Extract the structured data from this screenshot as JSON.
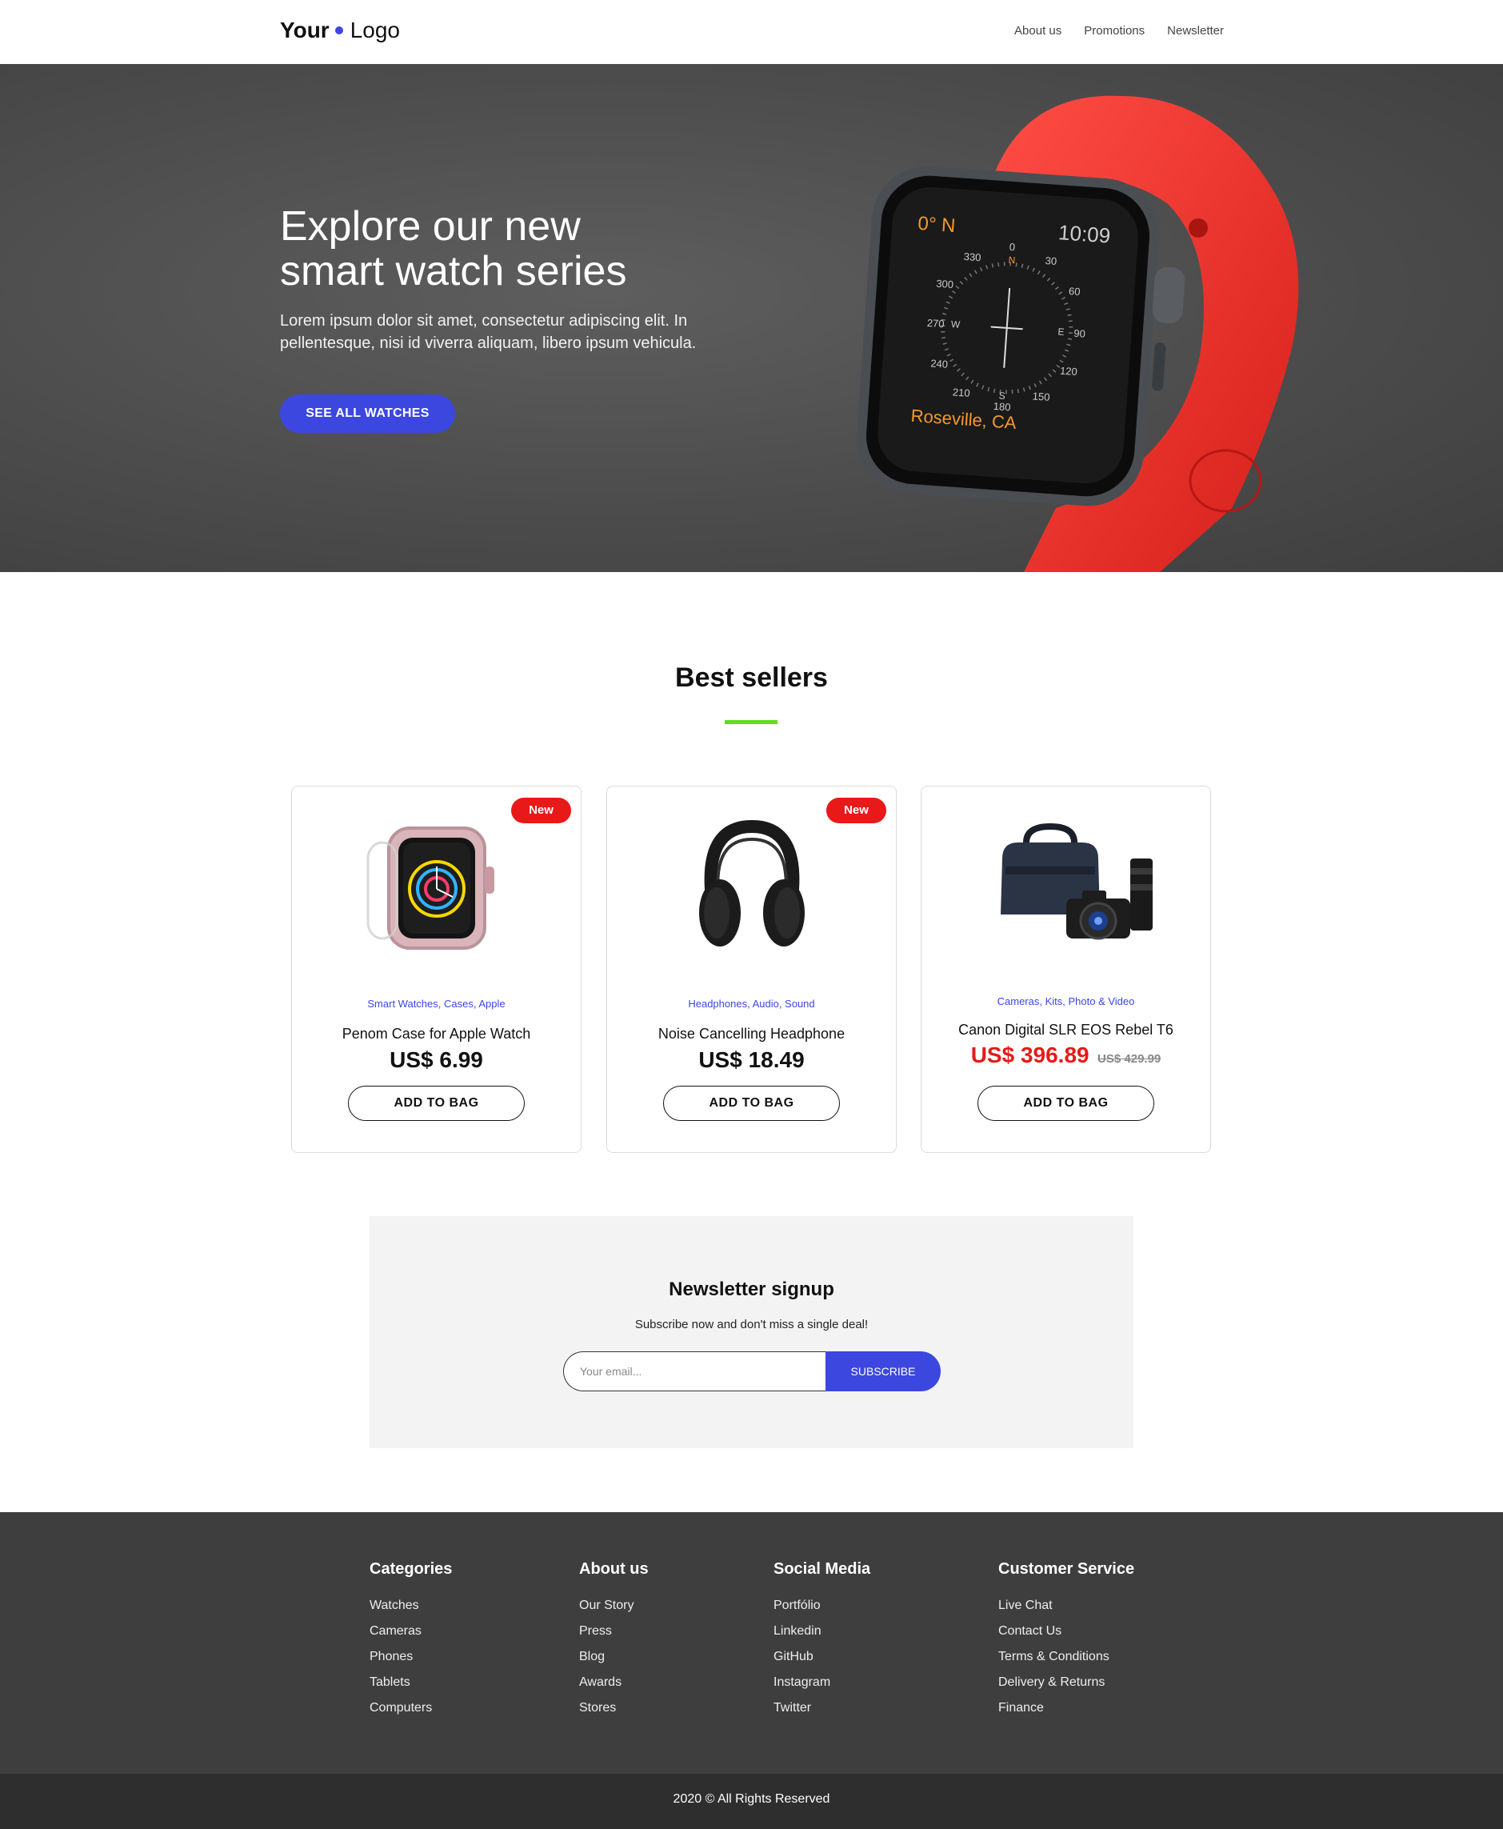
{
  "header": {
    "logo_bold": "Your",
    "logo_rest": "Logo",
    "nav": [
      "About us",
      "Promotions",
      "Newsletter"
    ]
  },
  "hero": {
    "title_line1": "Explore our new",
    "title_line2": "smart watch series",
    "text": "Lorem ipsum dolor sit amet, consectetur adipiscing elit. In pellentesque, nisi id viverra aliquam, libero ipsum vehicula.",
    "button": "SEE ALL WATCHES",
    "watch_screen": {
      "heading": "0° N",
      "time": "10:09",
      "location": "Roseville, CA",
      "dial_numbers": [
        "0",
        "30",
        "60",
        "90",
        "120",
        "150",
        "180",
        "210",
        "240",
        "270",
        "300",
        "330"
      ],
      "dial_letters": [
        "N",
        "E",
        "S",
        "W"
      ]
    }
  },
  "best_sellers": {
    "title": "Best sellers",
    "products": [
      {
        "badge": "New",
        "categories": "Smart Watches, Cases, Apple",
        "name": "Penom Case for Apple Watch",
        "price": "US$ 6.99",
        "old_price": "",
        "button": "ADD TO BAG"
      },
      {
        "badge": "New",
        "categories": "Headphones, Audio, Sound",
        "name": "Noise Cancelling Headphone",
        "price": "US$ 18.49",
        "old_price": "",
        "button": "ADD TO BAG"
      },
      {
        "badge": "",
        "categories": "Cameras, Kits, Photo & Video",
        "name": "Canon Digital SLR EOS Rebel T6",
        "price": "US$ 396.89",
        "old_price": "US$ 429.99",
        "button": "ADD TO BAG"
      }
    ]
  },
  "newsletter": {
    "title": "Newsletter signup",
    "subtitle": "Subscribe now and don't miss a single deal!",
    "placeholder": "Your email...",
    "button": "SUBSCRIBE"
  },
  "footer": {
    "columns": [
      {
        "title": "Categories",
        "links": [
          "Watches",
          "Cameras",
          "Phones",
          "Tablets",
          "Computers"
        ]
      },
      {
        "title": "About us",
        "links": [
          "Our Story",
          "Press",
          "Blog",
          "Awards",
          "Stores"
        ]
      },
      {
        "title": "Social Media",
        "links": [
          "Portfólio",
          "Linkedin",
          "GitHub",
          "Instagram",
          "Twitter"
        ]
      },
      {
        "title": "Customer Service",
        "links": [
          "Live Chat",
          "Contact Us",
          "Terms & Conditions",
          "Delivery & Returns",
          "Finance"
        ]
      }
    ],
    "copyright": "2020 © All Rights Reserved"
  },
  "colors": {
    "accent": "#3c47e0",
    "badge": "#e81919",
    "underline": "#5fdc1f",
    "hero_bg": "#4c4c4c",
    "footer_bg": "#3e3e3e",
    "bottom_bar": "#2e2e2e"
  }
}
